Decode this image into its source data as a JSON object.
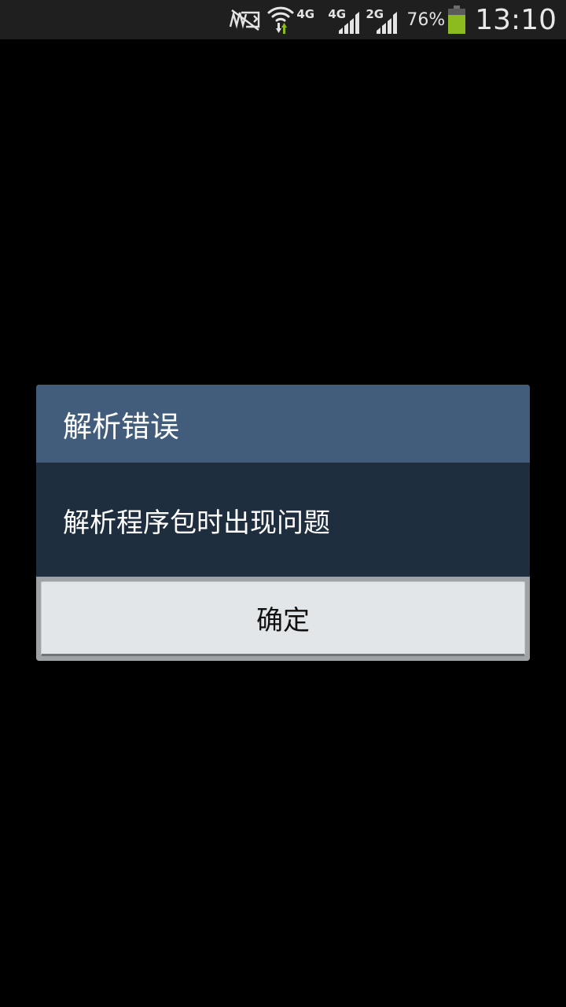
{
  "status_bar": {
    "network_labels": [
      "4G",
      "4G",
      "2G"
    ],
    "battery_percent": "76%",
    "battery_level": 0.76,
    "time": "13:10",
    "icons": [
      "no-sim-icon",
      "wifi-icon",
      "signal-4g-icon",
      "signal-4g-icon",
      "signal-2g-icon",
      "battery-icon"
    ],
    "battery_color": "#8cbb1f"
  },
  "dialog": {
    "title": "解析错误",
    "message": "解析程序包时出现问题",
    "ok_label": "确定",
    "colors": {
      "title_bg": "#415d7b",
      "body_bg": "#1f2e3e",
      "button_bg": "#e2e6e8"
    }
  }
}
